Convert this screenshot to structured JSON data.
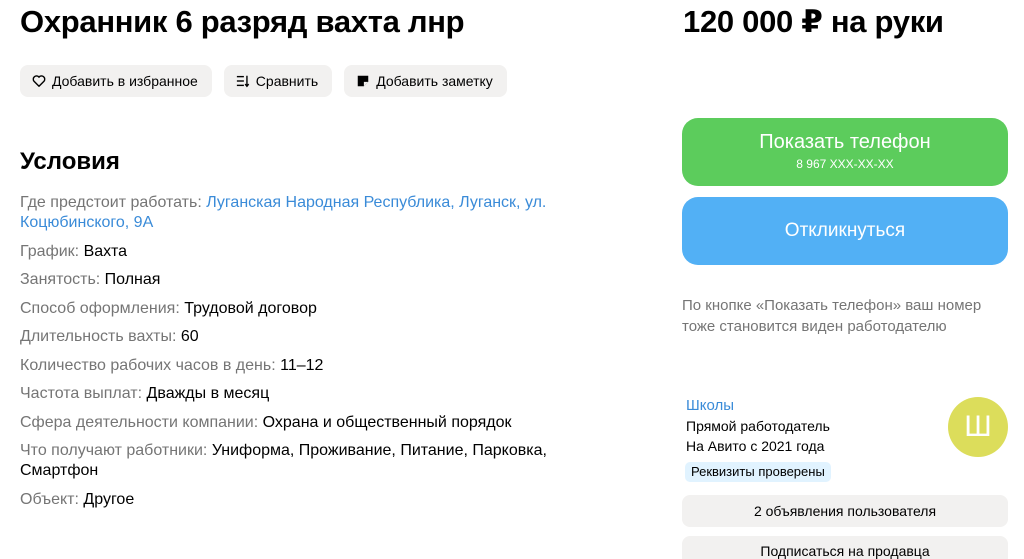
{
  "title": "Охранник 6 разряд вахта лнр",
  "price": "120 000 ₽ на руки",
  "actions": [
    {
      "icon": "heart-icon",
      "label": "Добавить в избранное"
    },
    {
      "icon": "compare-icon",
      "label": "Сравнить"
    },
    {
      "icon": "note-icon",
      "label": "Добавить заметку"
    }
  ],
  "conditions": {
    "heading": "Условия",
    "items": [
      {
        "key": "Где предстоит работать:",
        "value": "Луганская Народная Республика, Луганск, ул. Коцюбинского, 9А"
      },
      {
        "key": "График:",
        "value": "Вахта"
      },
      {
        "key": "Занятость:",
        "value": "Полная"
      },
      {
        "key": "Способ оформления:",
        "value": "Трудовой договор"
      },
      {
        "key": "Длительность вахты:",
        "value": "60"
      },
      {
        "key": "Количество рабочих часов в день:",
        "value": "11–12"
      },
      {
        "key": "Частота выплат:",
        "value": "Дважды в месяц"
      },
      {
        "key": "Сфера деятельности компании:",
        "value": "Охрана и общественный порядок"
      },
      {
        "key": "Что получают работники:",
        "value": "Униформа, Проживание, Питание, Парковка, Смартфон"
      },
      {
        "key": "Объект:",
        "value": "Другое"
      }
    ]
  },
  "contact": {
    "phone_label": "Показать телефон",
    "phone_masked": "8 967 XXX-XX-XX",
    "respond_label": "Откликнуться",
    "note": "По кнопке «Показать телефон» ваш номер тоже становится виден работодателю"
  },
  "seller": {
    "name": "Школы",
    "type": "Прямой работодатель",
    "since": "На Авито с 2021 года",
    "verified": "Реквизиты проверены",
    "avatar_letter": "Ш",
    "ads_button": "2 объявления пользователя",
    "subscribe_button": "Подписаться на продавца"
  },
  "colors": {
    "phone_button": "#5ccc5c",
    "respond_button": "#52b0f5",
    "link": "#3a8bd8",
    "avatar": "#dcdd5b",
    "verified_badge": "#e1f3ff"
  }
}
